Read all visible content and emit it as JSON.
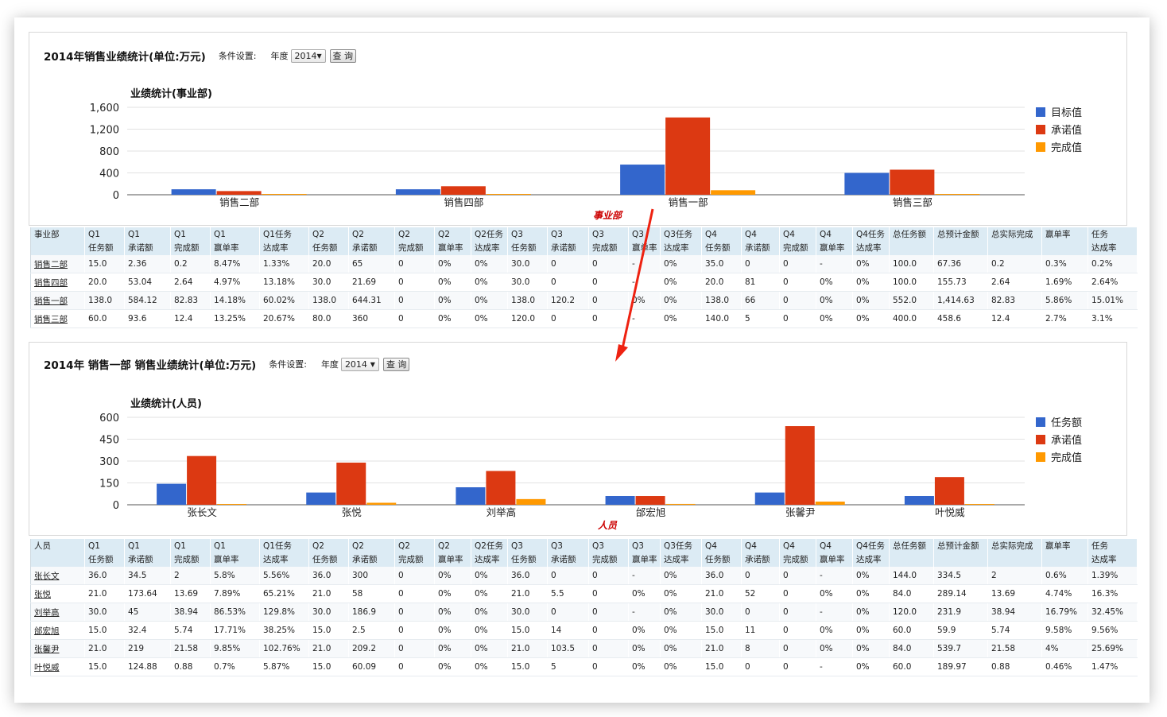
{
  "top": {
    "title": "2014年销售业绩统计(单位:万元)",
    "cond_label": "条件设置:",
    "year_label": "年度",
    "year_value": "2014",
    "query_button": "查 询",
    "chart_title": "业绩统计(事业部)",
    "x_caption": "事业部",
    "legend": [
      "目标值",
      "承诺值",
      "完成值"
    ],
    "head_row1": [
      "事业部",
      "Q1",
      "Q1",
      "Q1",
      "Q1",
      "Q1任务",
      "Q2",
      "Q2",
      "Q2",
      "Q2",
      "Q2任务",
      "Q3",
      "Q3",
      "Q3",
      "Q3",
      "Q3任务",
      "Q4",
      "Q4",
      "Q4",
      "Q4",
      "Q4任务",
      "总任务额",
      "总预计金额",
      "总实际完成",
      "赢单率",
      "任务"
    ],
    "head_row2": [
      "",
      "任务额",
      "承诺额",
      "完成额",
      "赢单率",
      "达成率",
      "任务额",
      "承诺额",
      "完成额",
      "赢单率",
      "达成率",
      "任务额",
      "承诺额",
      "完成额",
      "赢单率",
      "达成率",
      "任务额",
      "承诺额",
      "完成额",
      "赢单率",
      "达成率",
      "",
      "",
      "",
      "",
      "达成率"
    ],
    "rows": [
      [
        "销售二部",
        "15.0",
        "2.36",
        "0.2",
        "8.47%",
        "1.33%",
        "20.0",
        "65",
        "0",
        "0%",
        "0%",
        "30.0",
        "0",
        "0",
        "-",
        "0%",
        "35.0",
        "0",
        "0",
        "-",
        "0%",
        "100.0",
        "67.36",
        "0.2",
        "0.3%",
        "0.2%"
      ],
      [
        "销售四部",
        "20.0",
        "53.04",
        "2.64",
        "4.97%",
        "13.18%",
        "30.0",
        "21.69",
        "0",
        "0%",
        "0%",
        "30.0",
        "0",
        "0",
        "-",
        "0%",
        "20.0",
        "81",
        "0",
        "0%",
        "0%",
        "100.0",
        "155.73",
        "2.64",
        "1.69%",
        "2.64%"
      ],
      [
        "销售一部",
        "138.0",
        "584.12",
        "82.83",
        "14.18%",
        "60.02%",
        "138.0",
        "644.31",
        "0",
        "0%",
        "0%",
        "138.0",
        "120.2",
        "0",
        "0%",
        "0%",
        "138.0",
        "66",
        "0",
        "0%",
        "0%",
        "552.0",
        "1,414.63",
        "82.83",
        "5.86%",
        "15.01%"
      ],
      [
        "销售三部",
        "60.0",
        "93.6",
        "12.4",
        "13.25%",
        "20.67%",
        "80.0",
        "360",
        "0",
        "0%",
        "0%",
        "120.0",
        "0",
        "0",
        "-",
        "0%",
        "140.0",
        "5",
        "0",
        "0%",
        "0%",
        "400.0",
        "458.6",
        "12.4",
        "2.7%",
        "3.1%"
      ]
    ]
  },
  "bottom": {
    "title": "2014年 销售一部 销售业绩统计(单位:万元)",
    "cond_label": "条件设置:",
    "year_label": "年度",
    "year_value": "2014",
    "query_button": "查 询",
    "chart_title": "业绩统计(人员)",
    "x_caption": "人员",
    "legend": [
      "任务额",
      "承诺值",
      "完成值"
    ],
    "head_row1": [
      "人员",
      "Q1",
      "Q1",
      "Q1",
      "Q1",
      "Q1任务",
      "Q2",
      "Q2",
      "Q2",
      "Q2",
      "Q2任务",
      "Q3",
      "Q3",
      "Q3",
      "Q3",
      "Q3任务",
      "Q4",
      "Q4",
      "Q4",
      "Q4",
      "Q4任务",
      "总任务额",
      "总预计金额",
      "总实际完成",
      "赢单率",
      "任务"
    ],
    "head_row2": [
      "",
      "任务额",
      "承诺额",
      "完成额",
      "赢单率",
      "达成率",
      "任务额",
      "承诺额",
      "完成额",
      "赢单率",
      "达成率",
      "任务额",
      "承诺额",
      "完成额",
      "赢单率",
      "达成率",
      "任务额",
      "承诺额",
      "完成额",
      "赢单率",
      "达成率",
      "",
      "",
      "",
      "",
      "达成率"
    ],
    "rows": [
      [
        "张长文",
        "36.0",
        "34.5",
        "2",
        "5.8%",
        "5.56%",
        "36.0",
        "300",
        "0",
        "0%",
        "0%",
        "36.0",
        "0",
        "0",
        "-",
        "0%",
        "36.0",
        "0",
        "0",
        "-",
        "0%",
        "144.0",
        "334.5",
        "2",
        "0.6%",
        "1.39%"
      ],
      [
        "张悦",
        "21.0",
        "173.64",
        "13.69",
        "7.89%",
        "65.21%",
        "21.0",
        "58",
        "0",
        "0%",
        "0%",
        "21.0",
        "5.5",
        "0",
        "0%",
        "0%",
        "21.0",
        "52",
        "0",
        "0%",
        "0%",
        "84.0",
        "289.14",
        "13.69",
        "4.74%",
        "16.3%"
      ],
      [
        "刘举高",
        "30.0",
        "45",
        "38.94",
        "86.53%",
        "129.8%",
        "30.0",
        "186.9",
        "0",
        "0%",
        "0%",
        "30.0",
        "0",
        "0",
        "-",
        "0%",
        "30.0",
        "0",
        "0",
        "-",
        "0%",
        "120.0",
        "231.9",
        "38.94",
        "16.79%",
        "32.45%"
      ],
      [
        "邰宏旭",
        "15.0",
        "32.4",
        "5.74",
        "17.71%",
        "38.25%",
        "15.0",
        "2.5",
        "0",
        "0%",
        "0%",
        "15.0",
        "14",
        "0",
        "0%",
        "0%",
        "15.0",
        "11",
        "0",
        "0%",
        "0%",
        "60.0",
        "59.9",
        "5.74",
        "9.58%",
        "9.56%"
      ],
      [
        "张馨尹",
        "21.0",
        "219",
        "21.58",
        "9.85%",
        "102.76%",
        "21.0",
        "209.2",
        "0",
        "0%",
        "0%",
        "21.0",
        "103.5",
        "0",
        "0%",
        "0%",
        "21.0",
        "8",
        "0",
        "0%",
        "0%",
        "84.0",
        "539.7",
        "21.58",
        "4%",
        "25.69%"
      ],
      [
        "叶悦威",
        "15.0",
        "124.88",
        "0.88",
        "0.7%",
        "5.87%",
        "15.0",
        "60.09",
        "0",
        "0%",
        "0%",
        "15.0",
        "5",
        "0",
        "0%",
        "0%",
        "15.0",
        "0",
        "0",
        "-",
        "0%",
        "60.0",
        "189.97",
        "0.88",
        "0.46%",
        "1.47%"
      ]
    ]
  },
  "colors": {
    "blue": "#3366cc",
    "red": "#dc3912",
    "orange": "#ff9900",
    "arrow": "#ee2211",
    "caption": "#cc0000"
  },
  "chart_data": [
    {
      "type": "bar",
      "title": "业绩统计(事业部)",
      "xlabel": "事业部",
      "ylabel": "",
      "ylim": [
        0,
        1600
      ],
      "yticks": [
        "0",
        "400",
        "800",
        "1,200",
        "1,600"
      ],
      "categories": [
        "销售二部",
        "销售四部",
        "销售一部",
        "销售三部"
      ],
      "series": [
        {
          "name": "目标值",
          "color": "#3366cc",
          "values": [
            100,
            100,
            552,
            400
          ]
        },
        {
          "name": "承诺值",
          "color": "#dc3912",
          "values": [
            67.36,
            155.73,
            1414.63,
            458.6
          ]
        },
        {
          "name": "完成值",
          "color": "#ff9900",
          "values": [
            0.2,
            2.64,
            82.83,
            12.4
          ]
        }
      ],
      "legend": "right"
    },
    {
      "type": "bar",
      "title": "业绩统计(人员)",
      "xlabel": "人员",
      "ylabel": "",
      "ylim": [
        0,
        600
      ],
      "yticks": [
        "0",
        "150",
        "300",
        "450",
        "600"
      ],
      "categories": [
        "张长文",
        "张悦",
        "刘举高",
        "邰宏旭",
        "张馨尹",
        "叶悦威"
      ],
      "series": [
        {
          "name": "任务额",
          "color": "#3366cc",
          "values": [
            144,
            84,
            120,
            60,
            84,
            60
          ]
        },
        {
          "name": "承诺值",
          "color": "#dc3912",
          "values": [
            334.5,
            289.14,
            231.9,
            59.9,
            539.7,
            189.97
          ]
        },
        {
          "name": "完成值",
          "color": "#ff9900",
          "values": [
            2,
            13.69,
            38.94,
            5.74,
            21.58,
            0.88
          ]
        }
      ],
      "legend": "right"
    }
  ]
}
